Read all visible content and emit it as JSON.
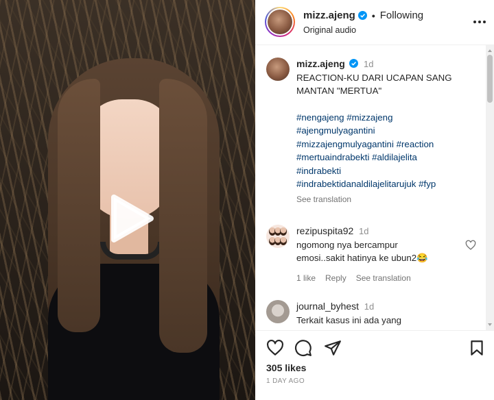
{
  "post": {
    "username": "mizz.ajeng",
    "following_label": "Following",
    "separator": "•",
    "audio": "Original audio"
  },
  "caption": {
    "username": "mizz.ajeng",
    "time": "1d",
    "lines": [
      "REACTION-KU DARI UCAPAN SANG",
      "MANTAN \"MERTUA\""
    ],
    "hashtags": [
      "#nengajeng #mizzajeng",
      "#ajengmulyagantini",
      "#mizzajengmulyagantini #reaction",
      "#mertuaindrabekti #aldilajelita",
      "#indrabekti",
      "#indrabektidanaldilajelitarujuk #fyp"
    ],
    "see_translation": "See translation"
  },
  "comments": [
    {
      "username": "rezipuspita92",
      "time": "1d",
      "lines": [
        "ngomong nya bercampur",
        "emosi..sakit hatinya ke ubun2😂"
      ],
      "likes": "1 like",
      "reply": "Reply",
      "see_translation": "See translation"
    },
    {
      "username": "journal_byhest",
      "time": "1d",
      "lines": [
        "Terkait kasus ini ada yang"
      ]
    }
  ],
  "footer": {
    "likes": "305 likes",
    "when": "1 DAY AGO"
  },
  "icons": {
    "verified": "verified-badge-icon",
    "more": "more-options-icon",
    "play": "play-icon",
    "like": "heart-icon",
    "comment": "comment-icon",
    "share": "paper-plane-icon",
    "save": "bookmark-icon"
  },
  "colors": {
    "verified": "#0095f6",
    "hashtag": "#00376b",
    "muted": "#737373"
  }
}
